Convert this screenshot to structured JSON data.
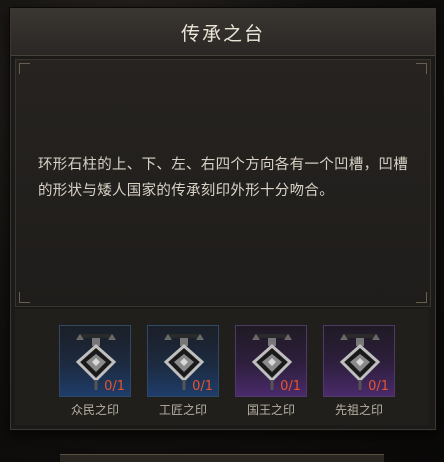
{
  "panel": {
    "title": "传承之台",
    "description": "环形石柱的上、下、左、右四个方向各有一个凹槽，凹槽的形状与矮人国家的传承刻印外形十分吻合。"
  },
  "seals": [
    {
      "name": "众民之印",
      "count": "0/1",
      "rarity": "blue",
      "icon": "seal-emblem-icon"
    },
    {
      "name": "工匠之印",
      "count": "0/1",
      "rarity": "blue",
      "icon": "seal-emblem-icon"
    },
    {
      "name": "国王之印",
      "count": "0/1",
      "rarity": "purple",
      "icon": "seal-emblem-icon"
    },
    {
      "name": "先祖之印",
      "count": "0/1",
      "rarity": "purple",
      "icon": "seal-emblem-icon"
    }
  ],
  "colors": {
    "count_text": "#e4552f",
    "blue_rarity": "#1f3d6a",
    "purple_rarity": "#4a2a6a"
  }
}
